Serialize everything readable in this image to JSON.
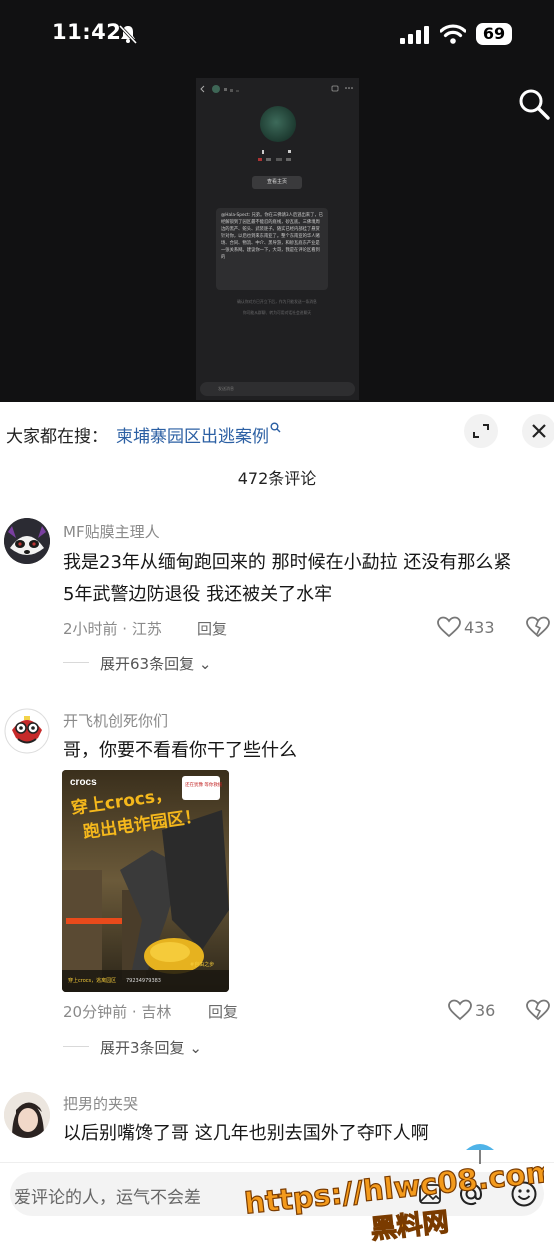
{
  "status_bar": {
    "time": "11:42",
    "battery": "69"
  },
  "video": {
    "screenshot_profile_button": "查看主页",
    "screenshot_message": "@Hala-Spect: 兄弟。你在三佛请3人后逃出来了，已经解锁到了园区最不能忍的底线，砂瓦底。三佛境周边的黑产、蛇头、武装匪子。随实已经内部挂了悬赏针对你，以后也到来东南亚了。整个东南亚的华人赌场、合同、物流、中介、黑导游，和砂瓦底东产业是一张关系网。建议你一下，大哥，我是在评论区看到的",
    "screenshot_note_1": "确认你对方已开立下后，作为只能发送一条消息",
    "screenshot_note_2": "你可能从群聊、转为可用对话社会进聊天",
    "screenshot_input": "发送消息"
  },
  "search_hint": {
    "prefix": "大家都在搜：",
    "query": "柬埔寨园区出逃案例"
  },
  "comments_header": {
    "count_label": "472条评论"
  },
  "comments": [
    {
      "username": "MF贴膜主理人",
      "text_line1": "我是23年从缅甸跑回来的 那时候在小勐拉 还没有那么紧",
      "text_line2": "5年武警边防退役 我还被关了水牢",
      "meta": "2小时前 · 江苏",
      "reply_label": "回复",
      "likes": "433",
      "expand_label": "展开63条回复"
    },
    {
      "username": "开飞机创死你们",
      "text_line1": "哥，你要不看看你干了些什么",
      "meta": "20分钟前 · 吉林",
      "reply_label": "回复",
      "likes": "36",
      "expand_label": "展开3条回复",
      "image": {
        "brand": "crocs",
        "headline_1": "穿上crocs，",
        "headline_2": "跑出电诈园区！",
        "badge": "还在犹豫 等你救援",
        "caption": "穿上crocs，逃离园区",
        "phone": "79234979383",
        "tag": "#自由之步"
      }
    },
    {
      "username": "把男的夹哭",
      "text_line1": "以后别嘴馋了哥 这几年也别去国外了夺吓人啊"
    }
  ],
  "input": {
    "placeholder": "爱评论的人，运气不会差"
  },
  "watermark": {
    "url": "https://hlwc08.com",
    "name": "黑料网"
  },
  "colors": {
    "link_blue": "#2b5fa3",
    "watermark_orange": "#f39a1c"
  }
}
